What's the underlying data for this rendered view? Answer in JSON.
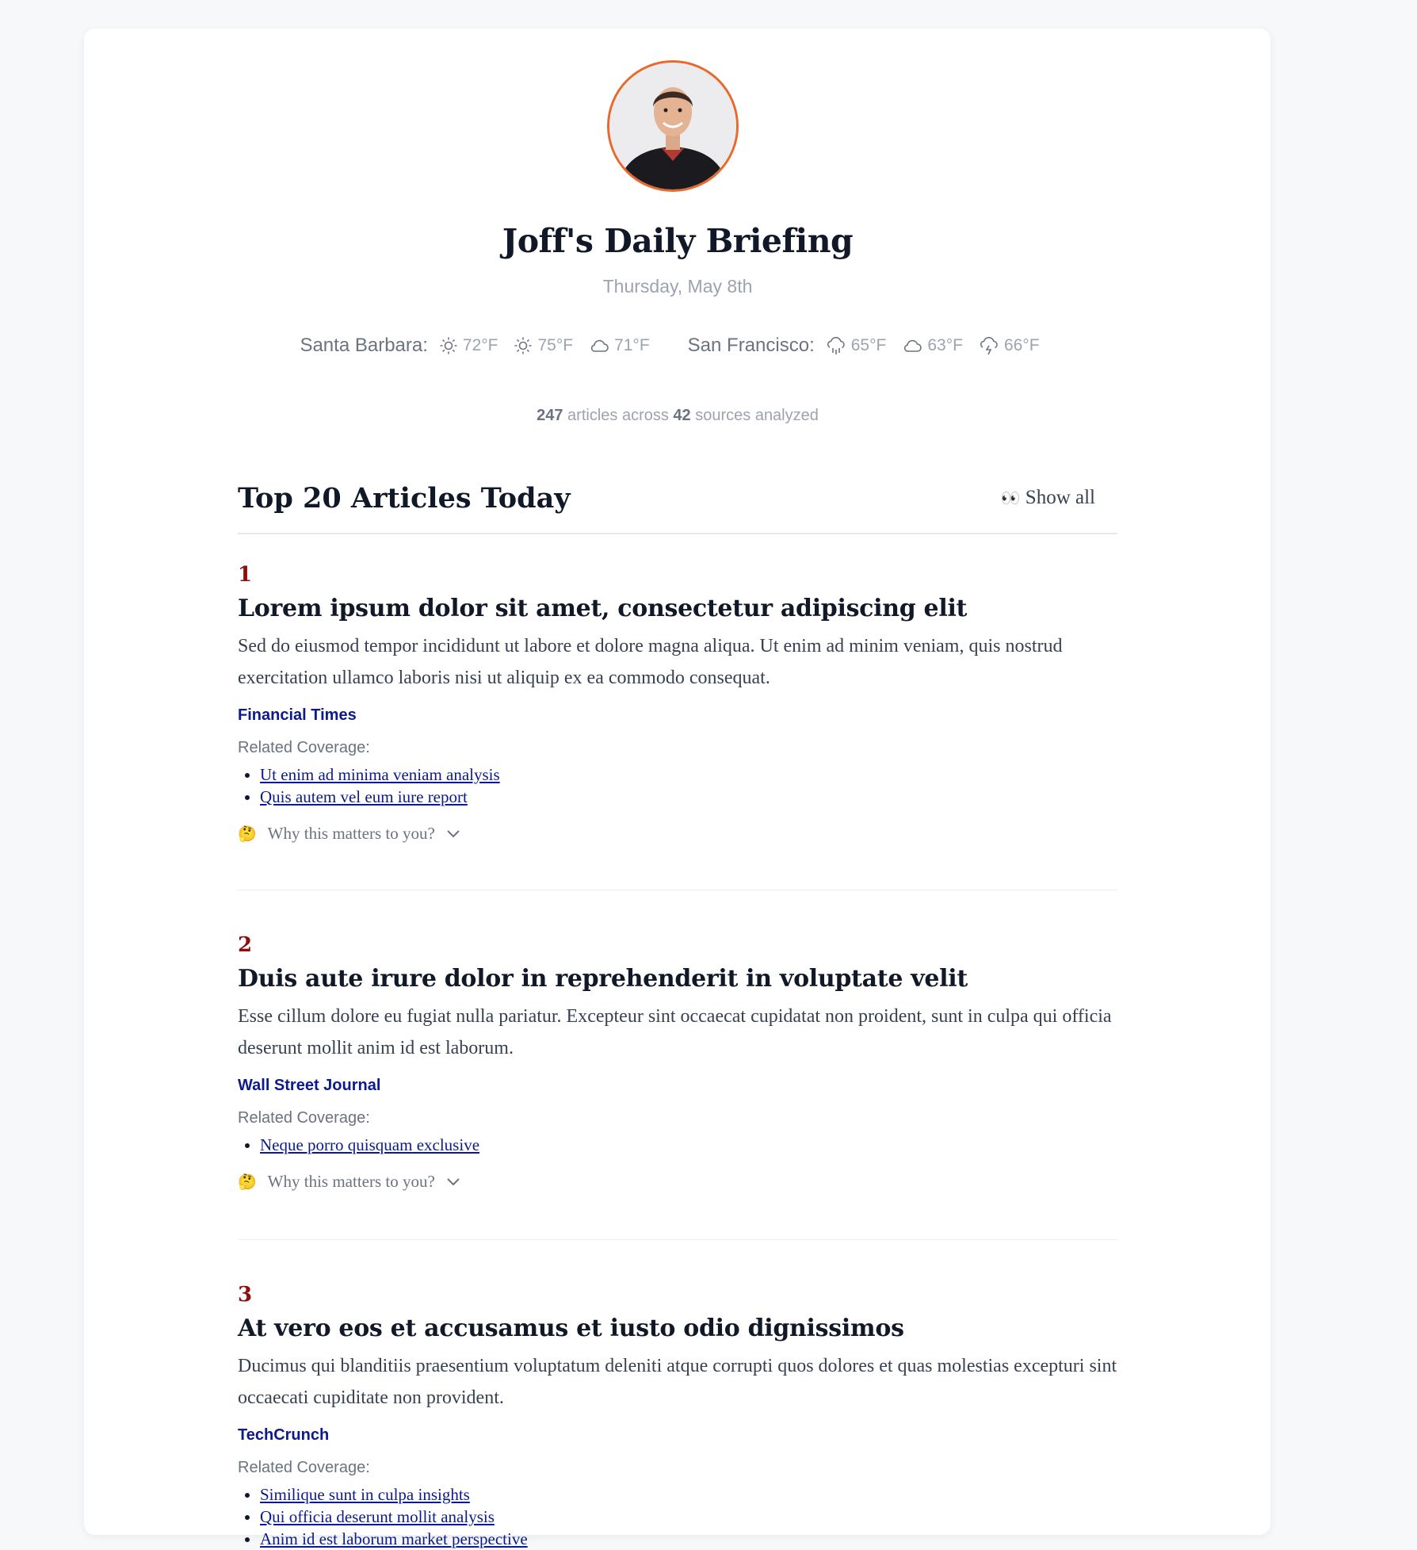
{
  "profile": {
    "name": "Joff"
  },
  "header": {
    "title": "Joff's Daily Briefing",
    "date": "Thursday, May 8th"
  },
  "weather": [
    {
      "city": "Santa Barbara:",
      "forecasts": [
        {
          "icon": "sun-icon",
          "temp": "72°F"
        },
        {
          "icon": "sun-icon",
          "temp": "75°F"
        },
        {
          "icon": "cloud-icon",
          "temp": "71°F"
        }
      ]
    },
    {
      "city": "San Francisco:",
      "forecasts": [
        {
          "icon": "rain-cloud-icon",
          "temp": "65°F"
        },
        {
          "icon": "cloud-icon",
          "temp": "63°F"
        },
        {
          "icon": "storm-cloud-icon",
          "temp": "66°F"
        }
      ]
    }
  ],
  "stats": {
    "articles_count": "247",
    "articles_text": " articles across ",
    "sources_count": "42",
    "sources_text": " sources analyzed"
  },
  "section": {
    "title": "Top 20 Articles Today",
    "show_all_emoji": "👀",
    "show_all_label": "Show all"
  },
  "related_label": "Related Coverage:",
  "why_label": "Why this matters to you?",
  "why_emoji": "🤔",
  "articles": [
    {
      "rank": "1",
      "headline": "Lorem ipsum dolor sit amet, consectetur adipiscing elit",
      "summary": "Sed do eiusmod tempor incididunt ut labore et dolore magna aliqua. Ut enim ad minim veniam, quis nostrud exercitation ullamco laboris nisi ut aliquip ex ea commodo consequat.",
      "source": "Financial Times",
      "related": [
        "Ut enim ad minima veniam analysis",
        "Quis autem vel eum iure report"
      ]
    },
    {
      "rank": "2",
      "headline": "Duis aute irure dolor in reprehenderit in voluptate velit",
      "summary": "Esse cillum dolore eu fugiat nulla pariatur. Excepteur sint occaecat cupidatat non proident, sunt in culpa qui officia deserunt mollit anim id est laborum.",
      "source": "Wall Street Journal",
      "related": [
        "Neque porro quisquam exclusive"
      ]
    },
    {
      "rank": "3",
      "headline": "At vero eos et accusamus et iusto odio dignissimos",
      "summary": "Ducimus qui blanditiis praesentium voluptatum deleniti atque corrupti quos dolores et quas molestias excepturi sint occaecati cupiditate non provident.",
      "source": "TechCrunch",
      "related": [
        "Similique sunt in culpa insights",
        "Qui officia deserunt mollit analysis",
        "Anim id est laborum market perspective"
      ]
    }
  ],
  "colors": {
    "accent_rank": "#8b0f0f",
    "source_link": "#0b1a8c",
    "avatar_border": "#e8692a"
  }
}
